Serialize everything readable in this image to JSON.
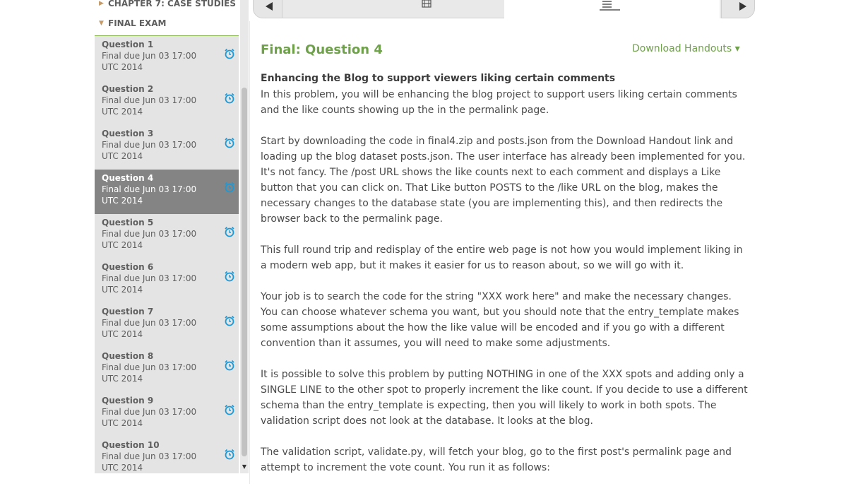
{
  "sidebar": {
    "chapter7_label": "CHAPTER 7: CASE STUDIES",
    "final_exam_label": "FINAL EXAM",
    "questions": [
      {
        "title": "Question 1",
        "due": "Final due Jun 03 17:00 UTC 2014"
      },
      {
        "title": "Question 2",
        "due": "Final due Jun 03 17:00 UTC 2014"
      },
      {
        "title": "Question 3",
        "due": "Final due Jun 03 17:00 UTC 2014"
      },
      {
        "title": "Question 4",
        "due": "Final due Jun 03 17:00 UTC 2014"
      },
      {
        "title": "Question 5",
        "due": "Final due Jun 03 17:00 UTC 2014"
      },
      {
        "title": "Question 6",
        "due": "Final due Jun 03 17:00 UTC 2014"
      },
      {
        "title": "Question 7",
        "due": "Final due Jun 03 17:00 UTC 2014"
      },
      {
        "title": "Question 8",
        "due": "Final due Jun 03 17:00 UTC 2014"
      },
      {
        "title": "Question 9",
        "due": "Final due Jun 03 17:00 UTC 2014"
      },
      {
        "title": "Question 10",
        "due": "Final due Jun 03 17:00 UTC 2014"
      }
    ],
    "active_question": "Question 4"
  },
  "nav": {
    "prev_icon": "triangle-left-icon",
    "next_icon": "triangle-right-icon",
    "tab1_icon": "film-icon",
    "tab2_icon": "list-icon"
  },
  "main": {
    "title": "Final: Question 4",
    "download_label": "Download Handouts ▾",
    "problem_heading": "Enhancing the Blog to support viewers liking certain comments",
    "paragraphs": [
      "In this problem, you will be enhancing the blog project to support users liking certain comments and the like counts showing up the in the permalink page.",
      "Start by downloading the code in final4.zip and posts.json from the Download Handout link and loading up the blog dataset posts.json. The user interface has already been implemented for you. It's not fancy. The /post URL shows the like counts next to each comment and displays a Like button that you can click on. That Like button POSTS to the /like URL on the blog, makes the necessary changes to the database state (you are implementing this), and then redirects the browser back to the permalink page.",
      "This full round trip and redisplay of the entire web page is not how you would implement liking in a modern web app, but it makes it easier for us to reason about, so we will go with it.",
      "Your job is to search the code for the string \"XXX work here\" and make the necessary changes. You can choose whatever schema you want, but you should note that the entry_template makes some assumptions about the how the like value will be encoded and if you go with a different convention than it assumes, you will need to make some adjustments.",
      "It is possible to solve this problem by putting NOTHING in one of the XXX spots and adding only a SINGLE LINE to the other spot to properly increment the like count. If you decide to use a different schema than the entry_template is expecting, then you will likely to work in both spots. The validation script does not look at the database. It looks at the blog.",
      "The validation script, validate.py, will fetch your blog, go to the first post's permalink page and attempt to increment the vote count. You run it as follows:"
    ]
  },
  "colors": {
    "accent_green": "#6ea14a",
    "active_item_bg": "#848484",
    "list_bg": "#e4e4e4",
    "alarm_blue": "#1a9ad8"
  }
}
